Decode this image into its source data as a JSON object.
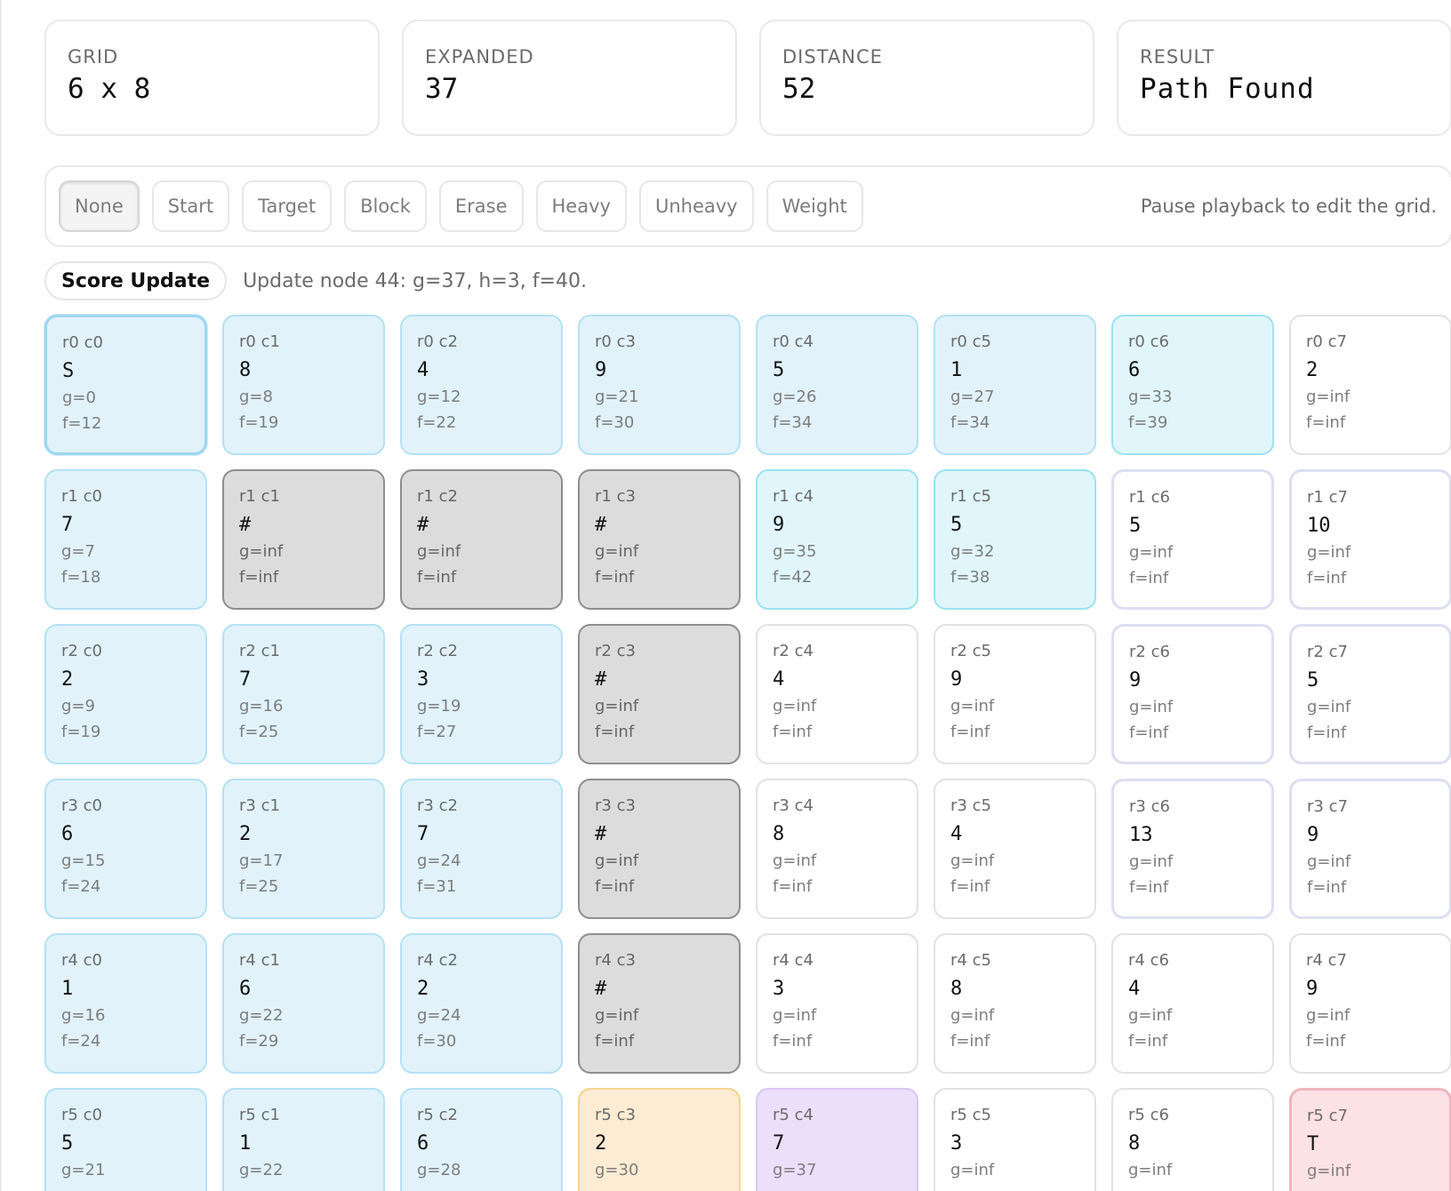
{
  "stats": [
    {
      "label": "GRID",
      "value": "6 x 8"
    },
    {
      "label": "EXPANDED",
      "value": "37"
    },
    {
      "label": "DISTANCE",
      "value": "52"
    },
    {
      "label": "RESULT",
      "value": "Path Found"
    }
  ],
  "toolbar": {
    "tools": [
      "None",
      "Start",
      "Target",
      "Block",
      "Erase",
      "Heavy",
      "Unheavy",
      "Weight"
    ],
    "active": "None",
    "hint": "Pause playback to edit the grid."
  },
  "step": {
    "badge": "Score Update",
    "text": "Update node 44: g=37, h=3, f=40."
  },
  "colors": {
    "visited": "#e1f2fb",
    "frontier": "#e0f6fb",
    "wall": "#dcdcdc",
    "current": "#fdebd3",
    "neighbor": "#ebdffa",
    "target": "#fde2e5"
  },
  "grid": {
    "rows": [
      [
        {
          "id": "r0 c0",
          "val": "S",
          "g": "g=0",
          "f": "f=12",
          "state": "start"
        },
        {
          "id": "r0 c1",
          "val": "8",
          "g": "g=8",
          "f": "f=19",
          "state": "visited"
        },
        {
          "id": "r0 c2",
          "val": "4",
          "g": "g=12",
          "f": "f=22",
          "state": "visited"
        },
        {
          "id": "r0 c3",
          "val": "9",
          "g": "g=21",
          "f": "f=30",
          "state": "visited"
        },
        {
          "id": "r0 c4",
          "val": "5",
          "g": "g=26",
          "f": "f=34",
          "state": "visited"
        },
        {
          "id": "r0 c5",
          "val": "1",
          "g": "g=27",
          "f": "f=34",
          "state": "visited"
        },
        {
          "id": "r0 c6",
          "val": "6",
          "g": "g=33",
          "f": "f=39",
          "state": "frontier"
        },
        {
          "id": "r0 c7",
          "val": "2",
          "g": "g=inf",
          "f": "f=inf",
          "state": "empty"
        }
      ],
      [
        {
          "id": "r1 c0",
          "val": "7",
          "g": "g=7",
          "f": "f=18",
          "state": "visited"
        },
        {
          "id": "r1 c1",
          "val": "#",
          "g": "g=inf",
          "f": "f=inf",
          "state": "wall"
        },
        {
          "id": "r1 c2",
          "val": "#",
          "g": "g=inf",
          "f": "f=inf",
          "state": "wall"
        },
        {
          "id": "r1 c3",
          "val": "#",
          "g": "g=inf",
          "f": "f=inf",
          "state": "wall"
        },
        {
          "id": "r1 c4",
          "val": "9",
          "g": "g=35",
          "f": "f=42",
          "state": "frontier"
        },
        {
          "id": "r1 c5",
          "val": "5",
          "g": "g=32",
          "f": "f=38",
          "state": "frontier"
        },
        {
          "id": "r1 c6",
          "val": "5",
          "g": "g=inf",
          "f": "f=inf",
          "state": "open"
        },
        {
          "id": "r1 c7",
          "val": "10",
          "g": "g=inf",
          "f": "f=inf",
          "state": "open"
        }
      ],
      [
        {
          "id": "r2 c0",
          "val": "2",
          "g": "g=9",
          "f": "f=19",
          "state": "visited"
        },
        {
          "id": "r2 c1",
          "val": "7",
          "g": "g=16",
          "f": "f=25",
          "state": "visited"
        },
        {
          "id": "r2 c2",
          "val": "3",
          "g": "g=19",
          "f": "f=27",
          "state": "visited"
        },
        {
          "id": "r2 c3",
          "val": "#",
          "g": "g=inf",
          "f": "f=inf",
          "state": "wall"
        },
        {
          "id": "r2 c4",
          "val": "4",
          "g": "g=inf",
          "f": "f=inf",
          "state": "empty"
        },
        {
          "id": "r2 c5",
          "val": "9",
          "g": "g=inf",
          "f": "f=inf",
          "state": "empty"
        },
        {
          "id": "r2 c6",
          "val": "9",
          "g": "g=inf",
          "f": "f=inf",
          "state": "open"
        },
        {
          "id": "r2 c7",
          "val": "5",
          "g": "g=inf",
          "f": "f=inf",
          "state": "open"
        }
      ],
      [
        {
          "id": "r3 c0",
          "val": "6",
          "g": "g=15",
          "f": "f=24",
          "state": "visited"
        },
        {
          "id": "r3 c1",
          "val": "2",
          "g": "g=17",
          "f": "f=25",
          "state": "visited"
        },
        {
          "id": "r3 c2",
          "val": "7",
          "g": "g=24",
          "f": "f=31",
          "state": "visited"
        },
        {
          "id": "r3 c3",
          "val": "#",
          "g": "g=inf",
          "f": "f=inf",
          "state": "wall"
        },
        {
          "id": "r3 c4",
          "val": "8",
          "g": "g=inf",
          "f": "f=inf",
          "state": "empty"
        },
        {
          "id": "r3 c5",
          "val": "4",
          "g": "g=inf",
          "f": "f=inf",
          "state": "empty"
        },
        {
          "id": "r3 c6",
          "val": "13",
          "g": "g=inf",
          "f": "f=inf",
          "state": "open"
        },
        {
          "id": "r3 c7",
          "val": "9",
          "g": "g=inf",
          "f": "f=inf",
          "state": "open"
        }
      ],
      [
        {
          "id": "r4 c0",
          "val": "1",
          "g": "g=16",
          "f": "f=24",
          "state": "visited"
        },
        {
          "id": "r4 c1",
          "val": "6",
          "g": "g=22",
          "f": "f=29",
          "state": "visited"
        },
        {
          "id": "r4 c2",
          "val": "2",
          "g": "g=24",
          "f": "f=30",
          "state": "visited"
        },
        {
          "id": "r4 c3",
          "val": "#",
          "g": "g=inf",
          "f": "f=inf",
          "state": "wall"
        },
        {
          "id": "r4 c4",
          "val": "3",
          "g": "g=inf",
          "f": "f=inf",
          "state": "empty"
        },
        {
          "id": "r4 c5",
          "val": "8",
          "g": "g=inf",
          "f": "f=inf",
          "state": "empty"
        },
        {
          "id": "r4 c6",
          "val": "4",
          "g": "g=inf",
          "f": "f=inf",
          "state": "empty"
        },
        {
          "id": "r4 c7",
          "val": "9",
          "g": "g=inf",
          "f": "f=inf",
          "state": "empty"
        }
      ],
      [
        {
          "id": "r5 c0",
          "val": "5",
          "g": "g=21",
          "f": "",
          "state": "visited"
        },
        {
          "id": "r5 c1",
          "val": "1",
          "g": "g=22",
          "f": "",
          "state": "visited"
        },
        {
          "id": "r5 c2",
          "val": "6",
          "g": "g=28",
          "f": "",
          "state": "visited"
        },
        {
          "id": "r5 c3",
          "val": "2",
          "g": "g=30",
          "f": "",
          "state": "current"
        },
        {
          "id": "r5 c4",
          "val": "7",
          "g": "g=37",
          "f": "",
          "state": "neighbor"
        },
        {
          "id": "r5 c5",
          "val": "3",
          "g": "g=inf",
          "f": "",
          "state": "empty"
        },
        {
          "id": "r5 c6",
          "val": "8",
          "g": "g=inf",
          "f": "",
          "state": "empty"
        },
        {
          "id": "r5 c7",
          "val": "T",
          "g": "g=inf",
          "f": "",
          "state": "target"
        }
      ]
    ]
  }
}
